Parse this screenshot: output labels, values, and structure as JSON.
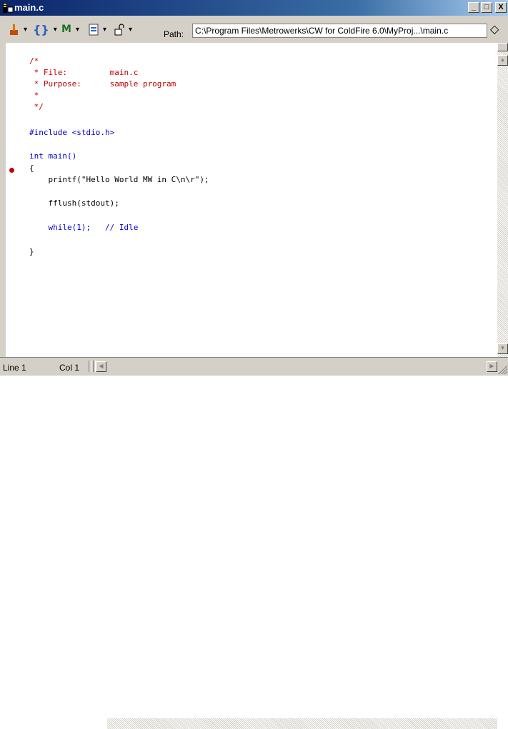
{
  "window": {
    "title": "main.c",
    "minimize": "_",
    "maximize": "□",
    "close": "X"
  },
  "toolbar": {
    "path_label": "Path:",
    "path_value": "C:\\Program Files\\Metrowerks\\CW for ColdFire 6.0\\MyProj...\\main.c",
    "diamond": "◇",
    "dropdown": "▾",
    "braces": "{}",
    "m_label": "M"
  },
  "code": {
    "lines": [
      "/*",
      " * File:         main.c",
      " * Purpose:      sample program",
      " *",
      " */",
      "#include <stdio.h>",
      "int main()",
      "{",
      "    printf(\"Hello World MW in C\\n\\r\");",
      "    fflush(stdout);",
      "    while(1);   // Idle",
      "}"
    ]
  },
  "status": {
    "line": "Line 1",
    "col": "Col 1"
  },
  "colors": {
    "comment": "#c00000",
    "keyword": "#0000c8",
    "string": "#606060",
    "breakpoint": "#c00000"
  }
}
